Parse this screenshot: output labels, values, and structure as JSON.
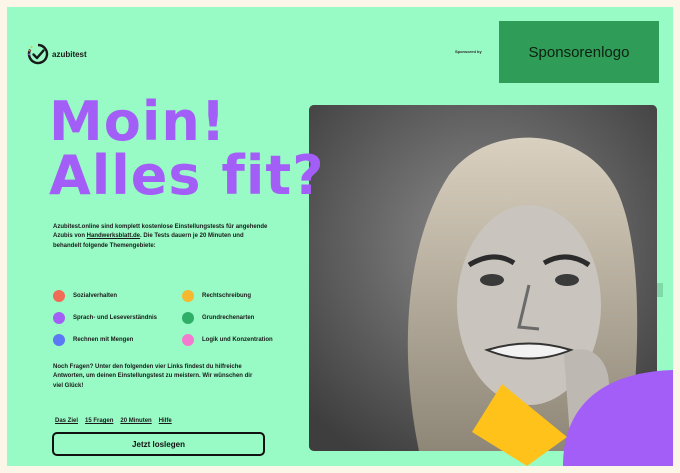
{
  "brand": {
    "name": "azubitest"
  },
  "sponsor": {
    "label": "Sponsored by",
    "logo_text": "Sponsorenlogo"
  },
  "headline": {
    "line1": "Moin!",
    "line2": "Alles fit?"
  },
  "intro": {
    "part1": "Azubitest.online sind komplett kostenlose Einstellungstests für angehende Azubis von ",
    "link": "Handwerksblatt.de",
    "part2": ". Die Tests dauern je 20 Minuten und behandelt folgende Themengebiete:"
  },
  "topics": [
    {
      "label": "Sozialverhalten",
      "color": "#f26b57"
    },
    {
      "label": "Rechtschreibung",
      "color": "#f5b82e"
    },
    {
      "label": "Sprach- und Leseverständnis",
      "color": "#a35ef7"
    },
    {
      "label": "Grundrechenarten",
      "color": "#2fae68"
    },
    {
      "label": "Rechnen mit Mengen",
      "color": "#5b78f5"
    },
    {
      "label": "Logik und Konzentration",
      "color": "#f27bd0"
    }
  ],
  "help_text": "Noch Fragen? Unter den folgenden vier Links findest du hilfreiche Antworten, um deinen Einstellungstest zu meistern. Wir wünschen dir viel Glück!",
  "links": [
    "Das Ziel",
    "15 Fragen",
    "20 Minuten",
    "Hilfe"
  ],
  "cta": {
    "label": "Jetzt loslegen"
  },
  "colors": {
    "background": "#98fac4",
    "accent_purple": "#a35ef7",
    "accent_yellow": "#ffc21a",
    "sponsor_green": "#2f9c57"
  }
}
